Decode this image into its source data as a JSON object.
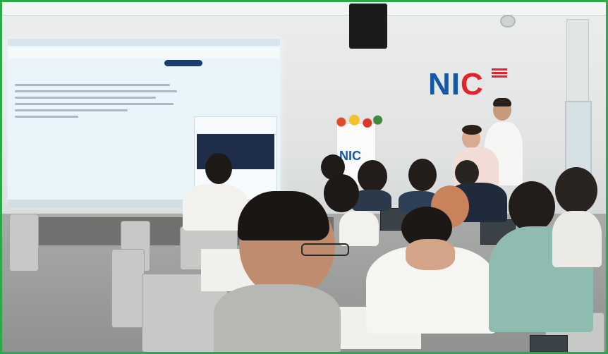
{
  "scene": {
    "description_label": "",
    "logo_text_main": "NI",
    "logo_text_accent": "C",
    "podium_logo": "NIC"
  },
  "colors": {
    "frame_border": "#2aa84a",
    "logo_blue": "#1558a8",
    "logo_red": "#e2232d",
    "screen_bg": "#eaf4fb"
  }
}
